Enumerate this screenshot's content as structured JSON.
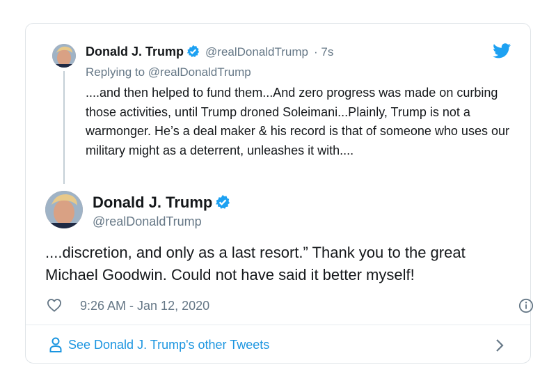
{
  "colors": {
    "twitter_blue": "#1da1f2",
    "link_blue": "#1b95e0",
    "text": "#14171a",
    "muted": "#657786"
  },
  "reply_tweet": {
    "name": "Donald J. Trump",
    "handle": "@realDonaldTrump",
    "time_ago": "· 7s",
    "replying_to": "Replying to @realDonaldTrump",
    "text": "....and then helped to fund them...And zero progress was made on curbing those activities, until Trump droned Soleimani...Plainly, Trump is not a warmonger. He’s a deal maker & his record is that of someone who uses our military might as a deterrent, unleashes it with....",
    "icons": [
      "avatar",
      "verified-badge-icon"
    ]
  },
  "main_tweet": {
    "name": "Donald J. Trump",
    "handle": "@realDonaldTrump",
    "text": "....discretion, and only as a last resort.” Thank you to the great Michael Goodwin. Could not have said it better myself!",
    "timestamp": "9:26 AM - Jan 12, 2020",
    "icons": [
      "avatar",
      "verified-badge-icon",
      "heart-icon",
      "info-icon"
    ]
  },
  "footer": {
    "link_label": "See Donald J. Trump's other Tweets",
    "icons": [
      "person-icon",
      "chevron-right-icon"
    ]
  },
  "brand_icon": "twitter-bird-icon"
}
